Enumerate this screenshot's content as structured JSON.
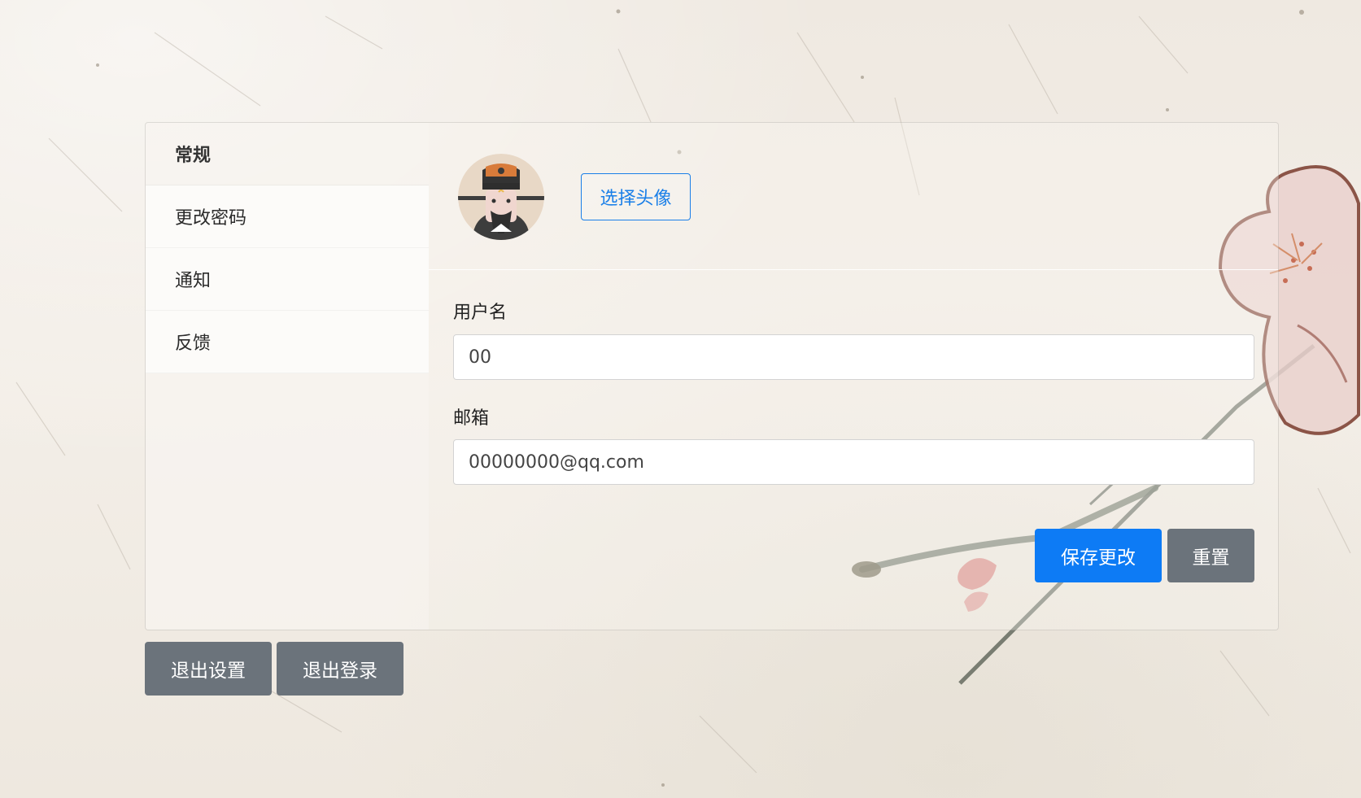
{
  "sidebar": {
    "items": [
      {
        "label": "常规",
        "active": true
      },
      {
        "label": "更改密码",
        "active": false
      },
      {
        "label": "通知",
        "active": false
      },
      {
        "label": "反馈",
        "active": false
      }
    ]
  },
  "profile": {
    "choose_avatar_label": "选择头像",
    "username": {
      "label": "用户名",
      "value": "00"
    },
    "email": {
      "label": "邮箱",
      "value": "00000000@qq.com"
    },
    "save_label": "保存更改",
    "reset_label": "重置"
  },
  "footer": {
    "exit_settings_label": "退出设置",
    "logout_label": "退出登录"
  },
  "colors": {
    "primary": "#0d7bf5",
    "secondary": "#6b737b",
    "link": "#1a7fe8"
  }
}
